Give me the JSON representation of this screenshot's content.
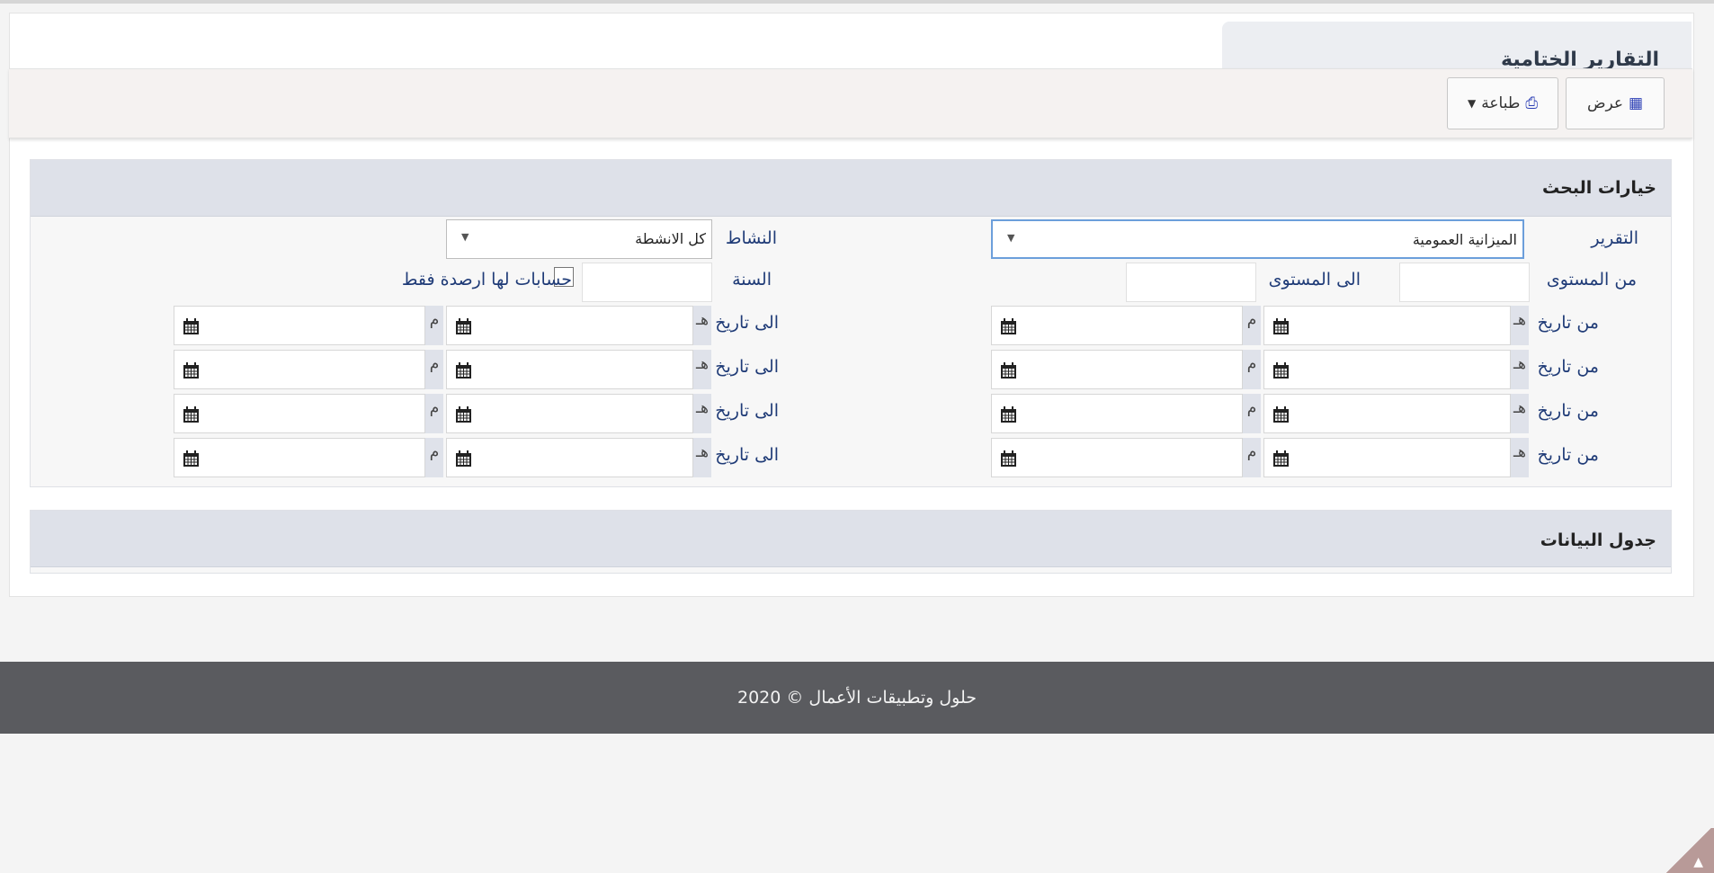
{
  "page": {
    "title": "التقارير الختامية"
  },
  "toolbar": {
    "view_label": "عرض",
    "print_label": "طباعة"
  },
  "search": {
    "title": "خيارات البحث",
    "report_label": "التقرير",
    "report_value": "الميزانية العمومية",
    "activity_label": "النشاط",
    "activity_value": "كل الانشطة",
    "from_level_label": "من المستوى",
    "to_level_label": "الى المستوى",
    "year_label": "السنة",
    "only_balances_label": "حسابات لها ارصدة فقط",
    "from_date_label": "من تاريخ",
    "to_date_label": "الى تاريخ",
    "hijri_suffix": "هـ",
    "gregorian_suffix": "م"
  },
  "table": {
    "title": "جدول البيانات"
  },
  "footer": {
    "text": "2020 © حلول وتطبيقات الأعمال"
  },
  "icons": {
    "view": "table-icon",
    "print": "print-icon",
    "calendar": "calendar-icon",
    "dropdown": "caret-down-icon",
    "scroll_top": "arrow-up-icon"
  },
  "colors": {
    "label": "#1f3b77",
    "header_bg": "#dee1e9",
    "footer_bg": "#5a5b5f",
    "accent": "#2c3fb5"
  }
}
